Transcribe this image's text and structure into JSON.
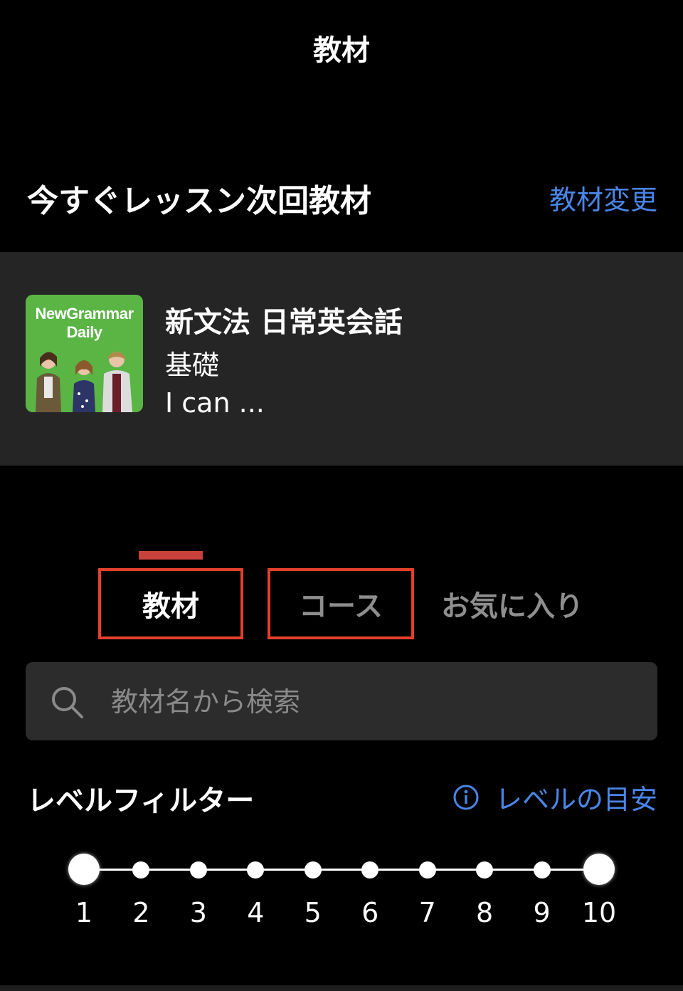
{
  "header": {
    "title": "教材"
  },
  "next_material": {
    "section_title": "今すぐレッスン次回教材",
    "change_label": "教材変更",
    "thumbnail_text_line1": "NewGrammar",
    "thumbnail_text_line2": "Daily",
    "title": "新文法 日常英会話",
    "level": "基礎",
    "description": "I can ..."
  },
  "tabs": [
    {
      "label": "教材",
      "selected": true
    },
    {
      "label": "コース",
      "selected": false
    },
    {
      "label": "お気に入り",
      "selected": false
    }
  ],
  "search": {
    "placeholder": "教材名から検索",
    "value": ""
  },
  "level_filter": {
    "title": "レベルフィルター",
    "guide_label": "レベルの目安",
    "levels": [
      "1",
      "2",
      "3",
      "4",
      "5",
      "6",
      "7",
      "8",
      "9",
      "10"
    ],
    "selected_min": 1,
    "selected_max": 10
  },
  "colors": {
    "accent_link": "#4a86e8",
    "tab_indicator": "#c8413a",
    "highlight_box": "#e2402b",
    "thumbnail_bg": "#5ab545"
  }
}
